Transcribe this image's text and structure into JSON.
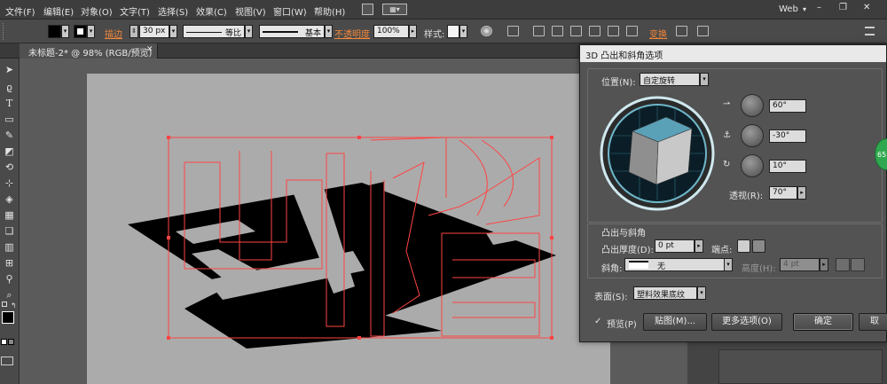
{
  "menubar": {
    "items": [
      "文件(F)",
      "编辑(E)",
      "对象(O)",
      "文字(T)",
      "选择(S)",
      "效果(C)",
      "视图(V)",
      "窗口(W)",
      "帮助(H)"
    ],
    "workspace": "Web",
    "window_controls": [
      "–",
      "❐",
      "✕"
    ]
  },
  "control_bar": {
    "stroke_label": "描边",
    "stroke_width": "30 px",
    "profile": "等比",
    "brush": "基本",
    "opacity_label": "不透明度",
    "opacity_value": "100%",
    "style_label": "样式:",
    "transform_label": "变换"
  },
  "document": {
    "tab_title": "未标题-2* @ 98% (RGB/预览)",
    "tab_close": "✕"
  },
  "dialog": {
    "title": "3D 凸出和斜角选项",
    "position_label": "位置(N):",
    "position_value": "自定旋转",
    "rotation_x": "60°",
    "rotation_y": "-30°",
    "rotation_z": "10°",
    "perspective_label": "透视(R):",
    "perspective_value": "70°",
    "extrude_section": "凸出与斜角",
    "extrude_depth_label": "凸出厚度(D):",
    "extrude_depth_value": "0 pt",
    "cap_label": "端点:",
    "bevel_label": "斜角:",
    "bevel_value": "无",
    "height_label": "高度(H):",
    "height_value": "4 pt",
    "surface_label": "表面(S):",
    "surface_value": "塑料效果底纹",
    "preview_label": "预览(P)",
    "preview_checked": true,
    "map_button": "贴图(M)...",
    "more_options_button": "更多选项(O)",
    "ok_button": "确定",
    "cancel_button_partial": "取"
  },
  "side_badge": "65",
  "colors": {
    "accent_orange": "#f1873a",
    "cube_top": "#5aa0b7",
    "cube_side": "#c8c8c8",
    "path_red": "#ff4444",
    "artboard": "#ababab"
  }
}
